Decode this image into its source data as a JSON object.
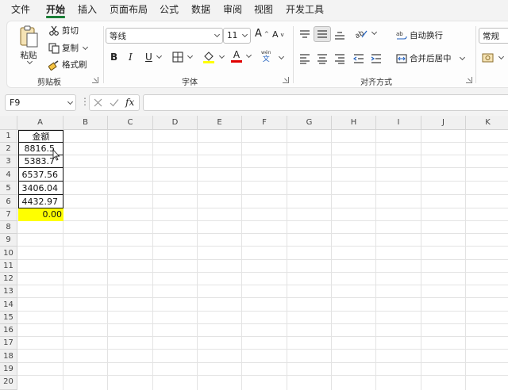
{
  "menu": {
    "tabs": [
      "文件",
      "开始",
      "插入",
      "页面布局",
      "公式",
      "数据",
      "审阅",
      "视图",
      "开发工具"
    ],
    "active_index": 1
  },
  "ribbon": {
    "clipboard": {
      "paste": "粘贴",
      "cut": "剪切",
      "copy": "复制",
      "format_painter": "格式刷",
      "group_label": "剪贴板"
    },
    "font": {
      "font_name": "等线",
      "font_size": "11",
      "bold": "B",
      "italic": "I",
      "underline": "U",
      "grow": "A",
      "shrink": "A",
      "phonetic_top": "wén",
      "phonetic_bottom": "文",
      "font_color_letter": "A",
      "highlight_color": "#ffff00",
      "font_color": "#e00000",
      "group_label": "字体"
    },
    "alignment": {
      "wrap_text": "自动换行",
      "merge_center": "合并后居中",
      "group_label": "对齐方式"
    },
    "number": {
      "format": "常规"
    }
  },
  "formula_bar": {
    "cell_ref": "F9",
    "fx": "fx",
    "formula": ""
  },
  "sheet": {
    "columns": [
      "A",
      "B",
      "C",
      "D",
      "E",
      "F",
      "G",
      "H",
      "I",
      "J",
      "K"
    ],
    "rows": [
      "1",
      "2",
      "3",
      "4",
      "5",
      "6",
      "7",
      "8",
      "9",
      "10",
      "11",
      "12",
      "13",
      "14",
      "15",
      "16",
      "17",
      "18",
      "19",
      "20"
    ],
    "cells": {
      "A1": "金额",
      "A2": "8816.5",
      "A3": "5383.7",
      "A4": "6537.56",
      "A5": "3406.04",
      "A6": "4432.97",
      "A7": "0.00"
    },
    "highlight_fill": "#ffff00",
    "accent": "#1a7f37"
  }
}
